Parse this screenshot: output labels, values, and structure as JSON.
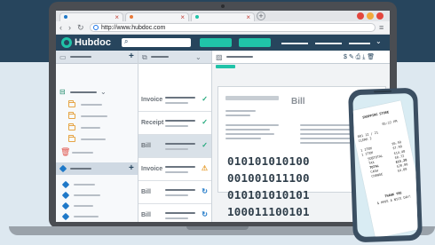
{
  "browser": {
    "url": "http://www.hubdoc.com"
  },
  "app": {
    "logo_text": "Hubdoc"
  },
  "documents": [
    {
      "type": "Invoice",
      "status": "check",
      "status_color": "#20a87a"
    },
    {
      "type": "Receipt",
      "status": "check",
      "status_color": "#20a87a"
    },
    {
      "type": "Bill",
      "status": "check",
      "status_color": "#20a87a"
    },
    {
      "type": "Invoice",
      "status": "warning",
      "status_color": "#e8a33a"
    },
    {
      "type": "Bill",
      "status": "sync",
      "status_color": "#1e78c8"
    },
    {
      "type": "Bill",
      "status": "sync",
      "status_color": "#1e78c8"
    }
  ],
  "preview": {
    "doc_label": "Bill",
    "toolbar_symbols": "$ ✎ ⎙ ⤓ 🗑",
    "binary_lines": [
      "010101010100",
      "001001011100",
      "010101010101",
      "100011100101"
    ]
  },
  "receipt": {
    "lines": [
      "SHOPPING STORE",
      "05:22 PM",
      "001 12 / 21",
      "CLERK 2",
      "1 ITEM",
      "1 ITEM",
      "SUBTOTAL",
      "TAX",
      "TOTAL",
      "CASH",
      "CHANGE",
      "$6.49",
      "$7.99",
      "$14.48",
      "$0.72",
      "$15.20",
      "$20.00",
      "$4.80",
      "THANK YOU",
      "& HAVE A NICE DAY!"
    ]
  },
  "colors": {
    "brand_navy": "#27455d",
    "accent_teal": "#20c3a8"
  }
}
